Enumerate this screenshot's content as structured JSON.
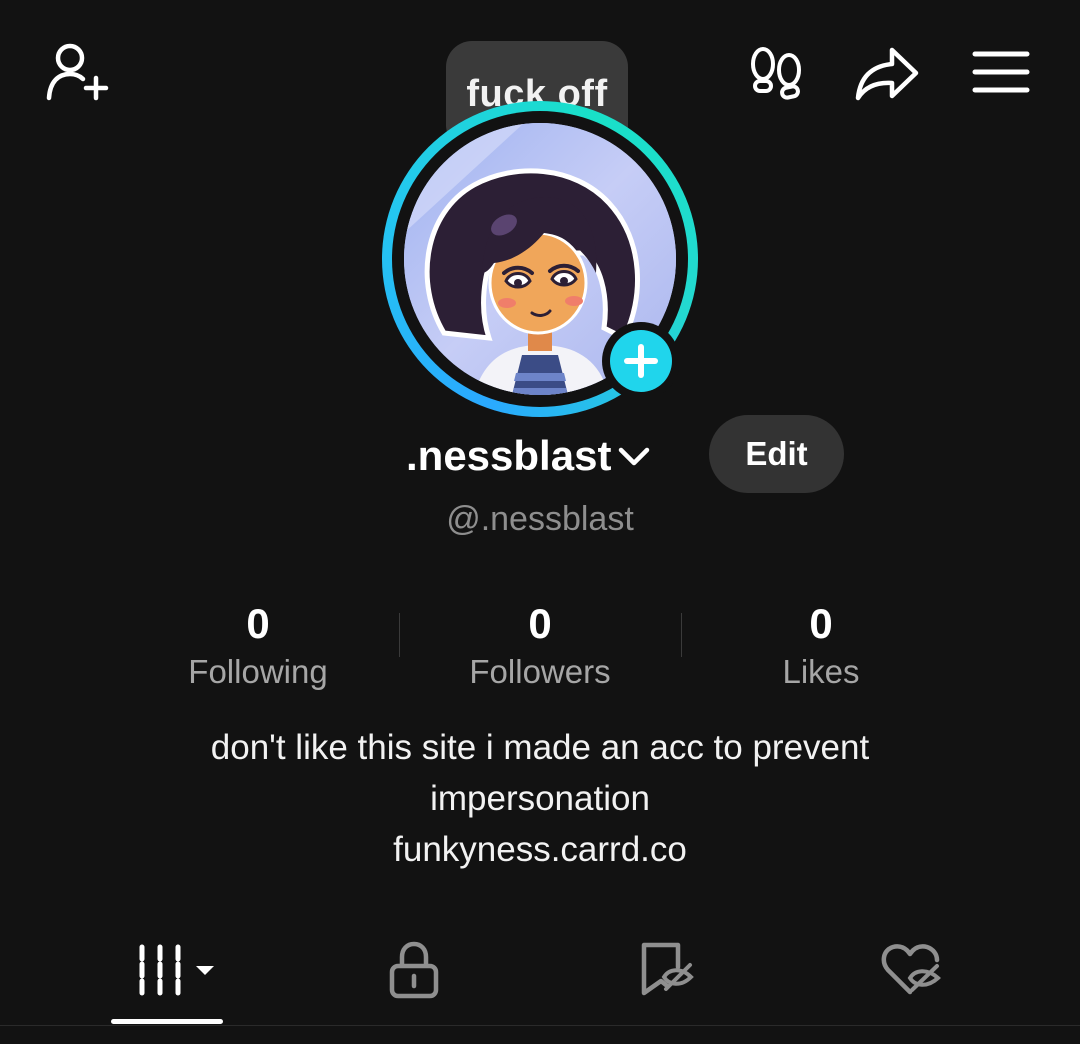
{
  "header": {
    "icons": [
      "add-friend-icon",
      "footprints-icon",
      "share-icon",
      "menu-icon"
    ]
  },
  "note": {
    "text": "fuck off"
  },
  "profile": {
    "display_name": ".nessblast",
    "handle": "@.nessblast",
    "edit_label": "Edit",
    "story_ring_colors": [
      "#2aa9ff",
      "#19e0c8"
    ],
    "add_story_color": "#20d5ec"
  },
  "stats": [
    {
      "value": "0",
      "label": "Following"
    },
    {
      "value": "0",
      "label": "Followers"
    },
    {
      "value": "0",
      "label": "Likes"
    }
  ],
  "bio": {
    "line1": "don't like this site i made an acc to prevent",
    "line2": "impersonation",
    "link": "funkyness.carrd.co"
  },
  "tabs": [
    {
      "icon": "videos-grid-icon",
      "active": true
    },
    {
      "icon": "lock-icon",
      "active": false
    },
    {
      "icon": "hidden-favorites-icon",
      "active": false
    },
    {
      "icon": "hidden-liked-icon",
      "active": false
    }
  ]
}
